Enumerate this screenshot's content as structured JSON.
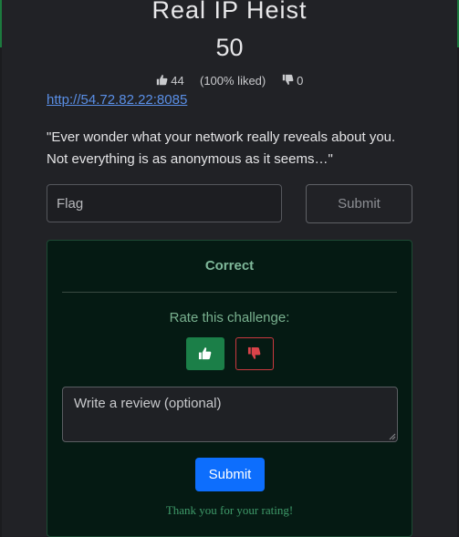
{
  "challenge": {
    "title": "Real IP Heist",
    "points": "50",
    "likes": "44",
    "liked_percent": "(100% liked)",
    "dislikes": "0",
    "link": "http://54.72.82.22:8085",
    "description": "\"Ever wonder what your network really reveals about you. Not everything is as anonymous as it seems…\""
  },
  "flag_form": {
    "placeholder": "Flag",
    "submit_label": "Submit"
  },
  "result": {
    "status": "Correct",
    "rate_prompt": "Rate this challenge:",
    "review_placeholder": "Write a review (optional)",
    "submit_label": "Submit",
    "thanks": "Thank you for your rating!"
  },
  "icons": {
    "likes": "thumbs-up-icon",
    "dislikes": "thumbs-down-icon"
  },
  "colors": {
    "like_button": "#1b7f48",
    "dislike_outline": "#c9393f",
    "primary_button": "#0d6efd",
    "link": "#5a8fe6",
    "correct_panel": "#051a13"
  }
}
